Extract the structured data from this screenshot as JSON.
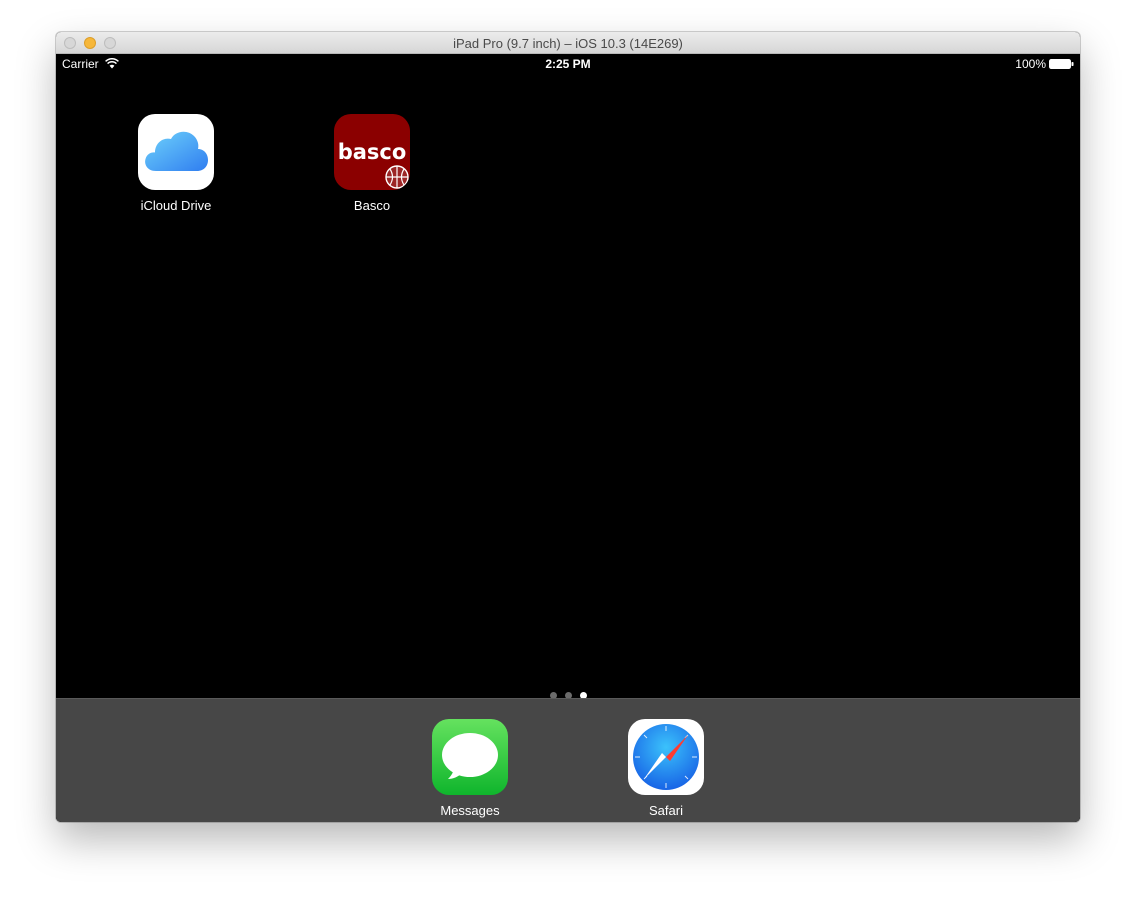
{
  "window": {
    "title": "iPad Pro (9.7 inch) – iOS 10.3 (14E269)"
  },
  "statusbar": {
    "carrier": "Carrier",
    "time": "2:25 PM",
    "battery": "100%",
    "wifi_icon": "wifi-icon",
    "battery_icon": "battery-icon"
  },
  "home": {
    "apps": [
      {
        "label": "iCloud Drive",
        "icon": "icloud-drive-icon"
      },
      {
        "label": "Basco",
        "icon": "basco-icon",
        "icon_text": "basco",
        "icon_color": "#8b0000"
      }
    ],
    "pages": {
      "count": 3,
      "current": 3
    }
  },
  "dock": {
    "apps": [
      {
        "label": "Messages",
        "icon": "messages-icon"
      },
      {
        "label": "Safari",
        "icon": "safari-icon"
      }
    ]
  },
  "colors": {
    "screen": "#000000",
    "dock": "#474747",
    "messages_green": "#34c749",
    "safari_blue": "#1e88e5"
  }
}
